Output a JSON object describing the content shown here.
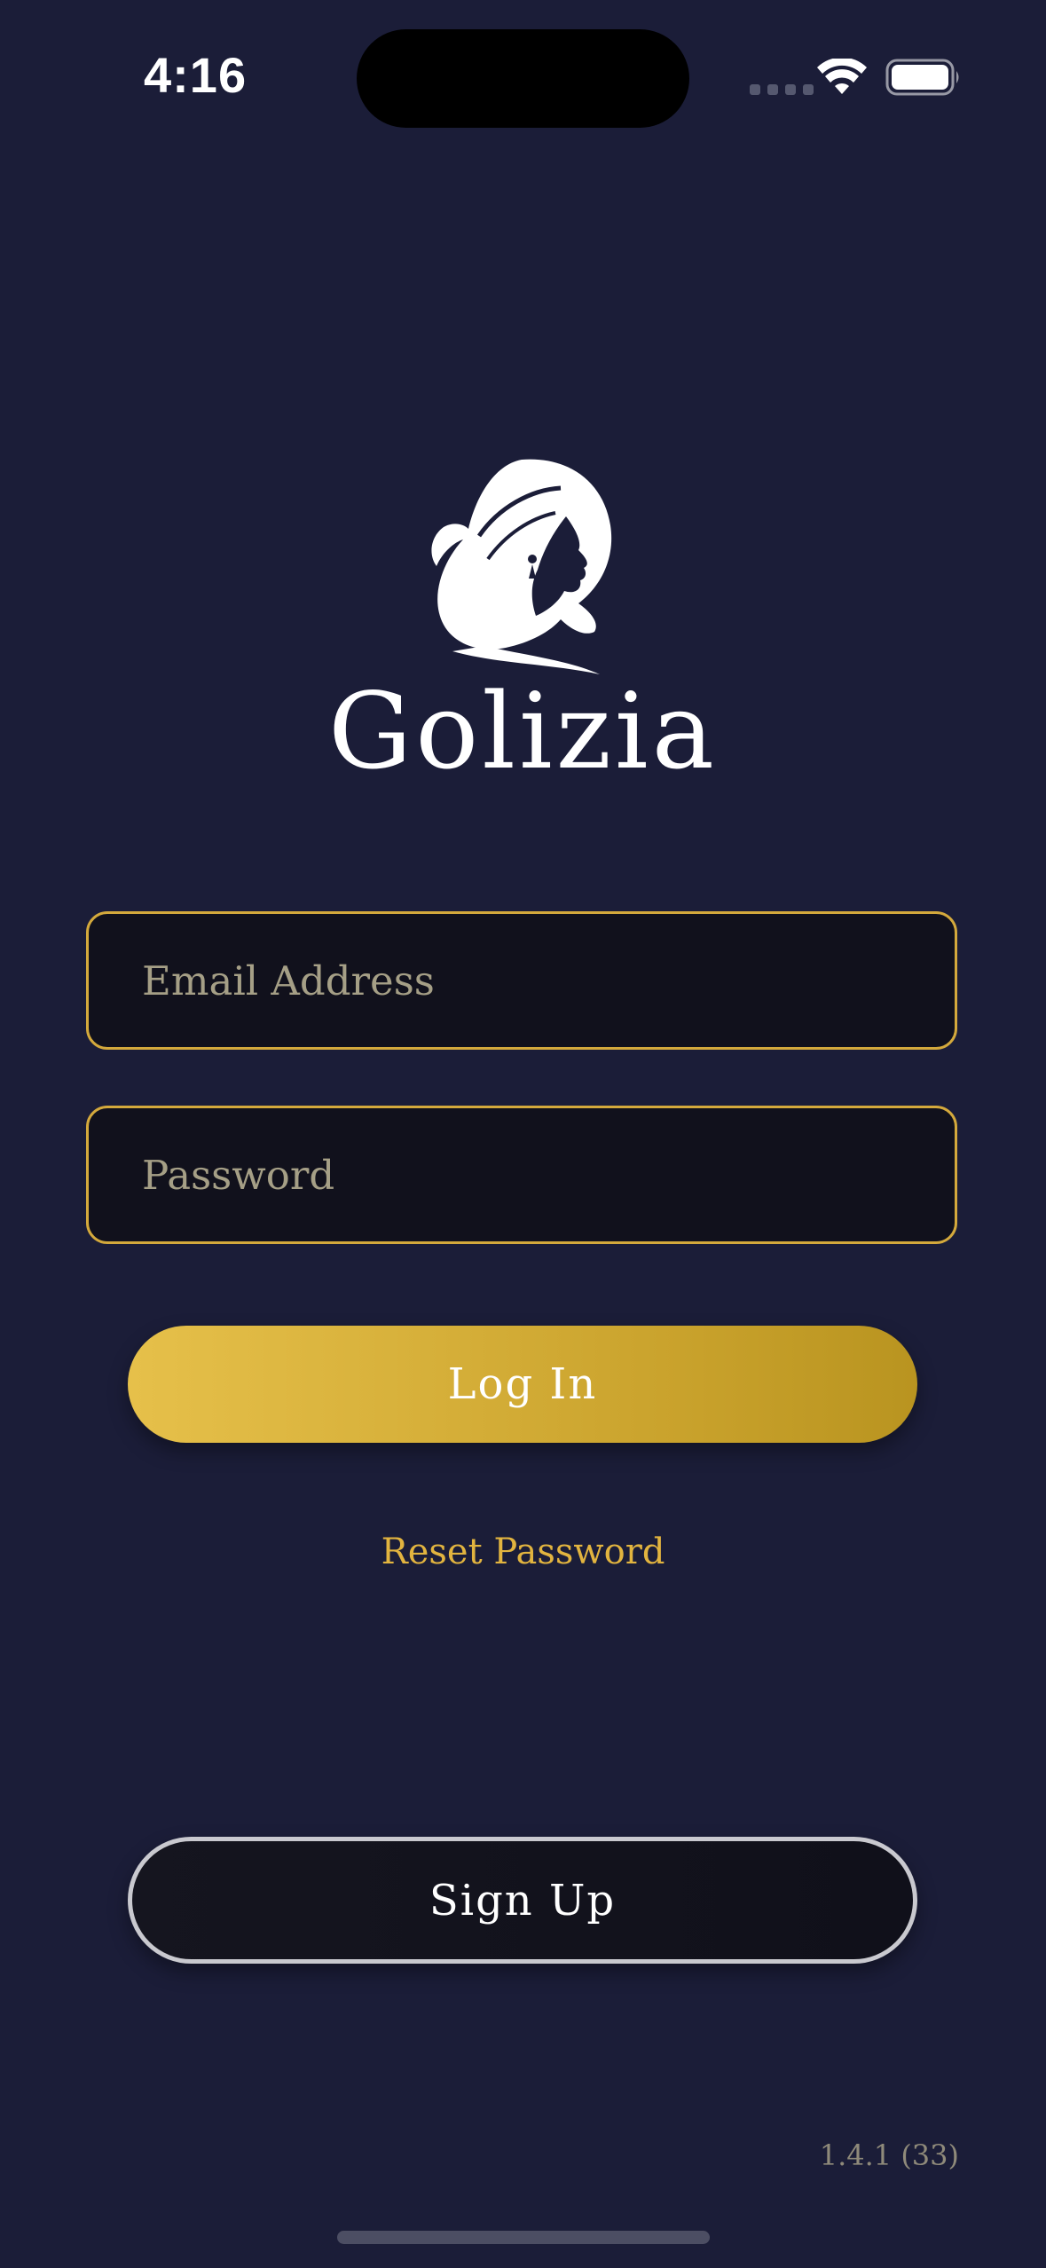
{
  "status_bar": {
    "time": "4:16"
  },
  "brand": {
    "name": "Golizia"
  },
  "form": {
    "email_placeholder": "Email Address",
    "email_value": "",
    "password_placeholder": "Password",
    "password_value": "",
    "login_label": "Log In",
    "reset_label": "Reset Password",
    "signup_label": "Sign Up"
  },
  "footer": {
    "version": "1.4.1 (33)"
  },
  "icons": {
    "logo": "woman-profile-logo-icon",
    "wifi": "wifi-icon",
    "battery": "battery-icon",
    "signal": "cellular-signal-icon"
  },
  "colors": {
    "background": "#1b1d38",
    "accent": "#d4a93c",
    "field_bg": "#11111c",
    "link": "#e2b43f"
  }
}
